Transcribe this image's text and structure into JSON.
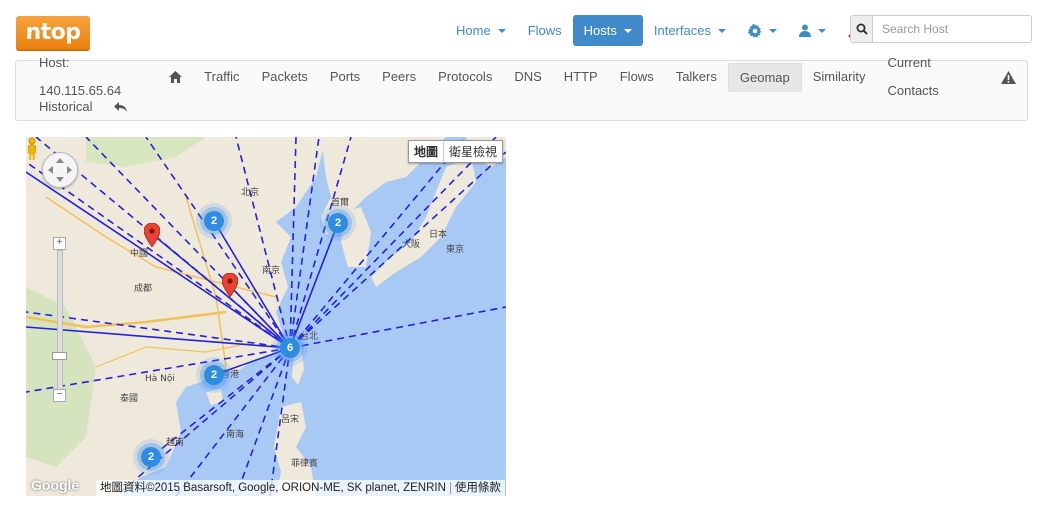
{
  "app": {
    "logo": "ntop"
  },
  "topnav": {
    "items": [
      {
        "label": "Home",
        "dropdown": true
      },
      {
        "label": "Flows",
        "dropdown": false
      },
      {
        "label": "Hosts",
        "dropdown": true,
        "active": true
      },
      {
        "label": "Interfaces",
        "dropdown": true
      }
    ],
    "icons": [
      "gear-icon",
      "user-icon",
      "alert-icon"
    ],
    "search_placeholder": "Search Host"
  },
  "subnav": {
    "host_label": "Host: 140.115.65.64",
    "items": [
      "Traffic",
      "Packets",
      "Ports",
      "Peers",
      "Protocols",
      "DNS",
      "HTTP",
      "Flows",
      "Talkers",
      "Geomap",
      "Similarity",
      "Current Contacts"
    ],
    "active": "Geomap",
    "row2": [
      "Historical"
    ]
  },
  "map": {
    "type_buttons": [
      "地圖",
      "衛星檢視"
    ],
    "active_type": "地圖",
    "attribution": "地圖資料©2015 Basarsoft, Google, ORION-ME, SK planet, ZENRIN",
    "terms": "使用條款",
    "google": "Google",
    "clusters": [
      "2",
      "2",
      "6",
      "2",
      "2"
    ],
    "place_labels": [
      "北京",
      "中國",
      "日本",
      "東京",
      "大阪",
      "首爾",
      "成都",
      "南京",
      "Hà Nội",
      "泰國",
      "南海",
      "香港",
      "台北",
      "菲律賓",
      "呂宋",
      "越南"
    ]
  }
}
